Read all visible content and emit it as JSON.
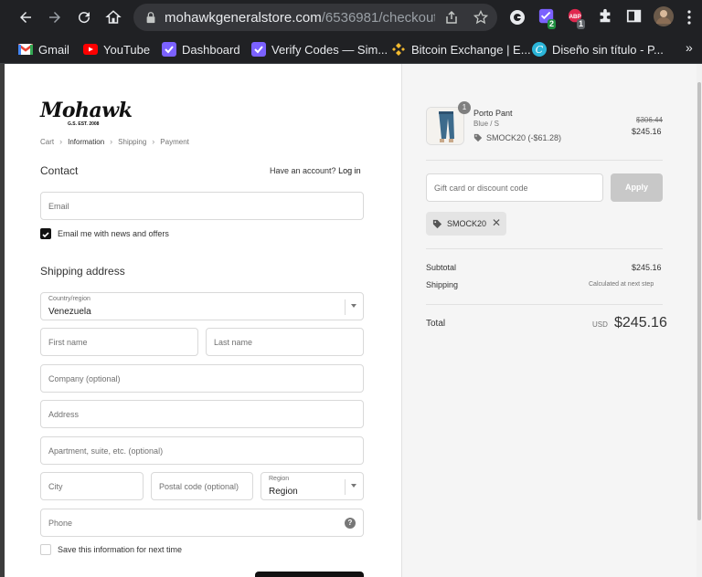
{
  "browser": {
    "url_host": "mohawkgeneralstore.com",
    "url_path": "/6536981/checkout...",
    "extensions": [
      {
        "name": "grammarly-icon",
        "badge": ""
      },
      {
        "name": "verify-codes-ext-icon",
        "badge": "2"
      },
      {
        "name": "adblock-icon",
        "badge": "1"
      }
    ]
  },
  "bookmarks": [
    {
      "label": "Gmail"
    },
    {
      "label": "YouTube"
    },
    {
      "label": "Dashboard"
    },
    {
      "label": "Verify Codes — Sim..."
    },
    {
      "label": "Bitcoin Exchange | E..."
    },
    {
      "label": "Diseño sin título - P..."
    }
  ],
  "store": {
    "logo": "Mohawk",
    "logo_sub": "G.S. EST. 2008"
  },
  "breadcrumbs": [
    "Cart",
    "Information",
    "Shipping",
    "Payment"
  ],
  "contact": {
    "title": "Contact",
    "have_account": "Have an account?",
    "login": "Log in",
    "email_placeholder": "Email",
    "news_label": "Email me with news and offers",
    "news_checked": true
  },
  "shipping": {
    "title": "Shipping address",
    "country_label": "Country/region",
    "country_value": "Venezuela",
    "first_name": "First name",
    "last_name": "Last name",
    "company": "Company (optional)",
    "address": "Address",
    "apartment": "Apartment, suite, etc. (optional)",
    "city": "City",
    "postal": "Postal code (optional)",
    "region_label": "Region",
    "region_value": "Region",
    "phone": "Phone",
    "save_label": "Save this information for next time",
    "save_checked": false
  },
  "summary": {
    "product": {
      "quantity": "1",
      "name": "Porto Pant",
      "variant": "Blue / S",
      "discount": "SMOCK20 (-$61.28)",
      "old_price": "$306.44",
      "price": "$245.16"
    },
    "gift_placeholder": "Gift card or discount code",
    "apply_label": "Apply",
    "applied_code": "SMOCK20",
    "subtotal_label": "Subtotal",
    "subtotal_value": "$245.16",
    "shipping_label": "Shipping",
    "shipping_value": "Calculated at next step",
    "total_label": "Total",
    "currency": "USD",
    "total_value": "$245.16"
  },
  "colors": {
    "chrome_bg": "#202124",
    "summary_bg": "#f5f5f5",
    "button_dark": "#111111",
    "apply_disabled": "#c8c8c8"
  }
}
